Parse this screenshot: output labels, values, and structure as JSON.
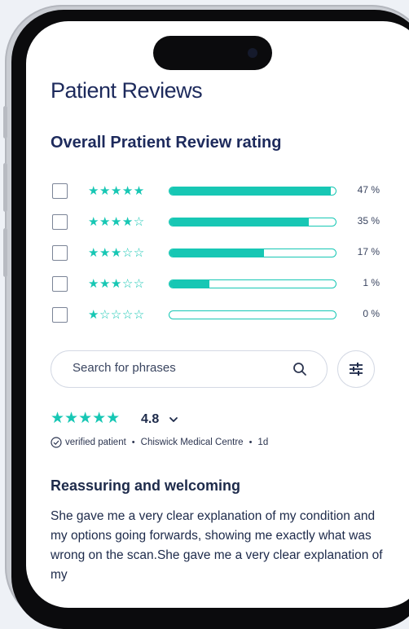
{
  "page": {
    "title": "Patient Reviews"
  },
  "rating_section": {
    "title": "Overall Pratient Review rating",
    "rows": [
      {
        "stars_filled": 5,
        "stars": "★★★★★",
        "percent_label": "47 %",
        "fill": 0.97
      },
      {
        "stars_filled": 4,
        "stars": "★★★★☆",
        "percent_label": "35 %",
        "fill": 0.84
      },
      {
        "stars_filled": 3,
        "stars": "★★★☆☆",
        "percent_label": "17 %",
        "fill": 0.57
      },
      {
        "stars_filled": 3,
        "stars": "★★★☆☆",
        "percent_label": "1 %",
        "fill": 0.24
      },
      {
        "stars_filled": 1,
        "stars": "★☆☆☆☆",
        "percent_label": "0 %",
        "fill": 0.0
      }
    ]
  },
  "search": {
    "placeholder": "Search for phrases",
    "icon": "search-icon",
    "filter_icon": "sliders-icon"
  },
  "review": {
    "stars": "★★★★★",
    "score": "4.8",
    "verified": "verified patient",
    "location": "Chiswick Medical Centre",
    "age": "1d",
    "title": "Reassuring and welcoming",
    "body": "She gave me a very clear explanation of my condition and my options going forwards, showing me exactly what was wrong on the scan.She gave me a very clear explanation of my"
  },
  "colors": {
    "accent": "#17c7b4",
    "heading": "#1d2a5c",
    "frame": "#0b0b0d"
  }
}
